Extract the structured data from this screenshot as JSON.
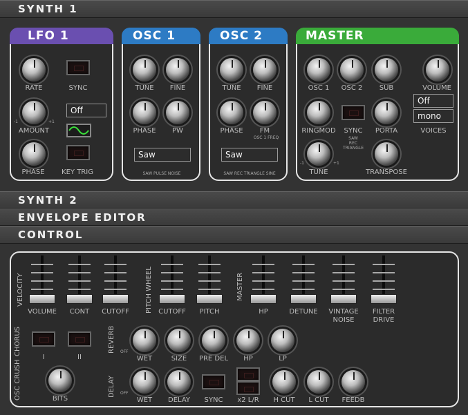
{
  "sections": {
    "synth1": "SYNTH 1",
    "synth2": "SYNTH 2",
    "envelope": "ENVELOPE EDITOR",
    "control": "CONTROL"
  },
  "lfo1": {
    "title": "LFO 1",
    "color": "#6a4fb0",
    "rate": "RATE",
    "sync": "SYNC",
    "sync_value": "Off",
    "amount": "AMOUNT",
    "phase": "PHASE",
    "key_trig": "KEY TRIG",
    "minus": "-1",
    "plus": "+1",
    "wave_icon": "sine-wave-icon"
  },
  "osc1": {
    "title": "OSC 1",
    "color": "#2d7bc4",
    "tune": "TUNE",
    "fine": "FINE",
    "phase": "PHASE",
    "pw": "PW",
    "wave": "Saw",
    "options": "SAW PULSE NOISE",
    "minus": "-1",
    "plus": "+1"
  },
  "osc2": {
    "title": "OSC 2",
    "color": "#2d7bc4",
    "tune": "TUNE",
    "fine": "FINE",
    "phase": "PHASE",
    "fm": "FM",
    "fm_sub": "OSC 1 FREQ",
    "wave": "Saw",
    "options": "SAW REC TRIANGLE SINE",
    "plus": "+1"
  },
  "master": {
    "title": "MASTER",
    "color": "#3aab3a",
    "osc1": "OSC 1",
    "osc2": "OSC 2",
    "sub": "SUB",
    "volume": "VOLUME",
    "ringmod": "RINGMOD",
    "sync": "SYNC",
    "sync_opts": [
      "SAW",
      "REC",
      "TRIANGLE"
    ],
    "porta": "PORTA",
    "porta_value": "Off",
    "voices_value": "mono",
    "voices": "VOICES",
    "tune": "TUNE",
    "transpose": "TRANSPOSE",
    "minus": "-1",
    "plus": "+1"
  },
  "control": {
    "velocity": "VELOCITY",
    "pitch_wheel": "PITCH WHEEL",
    "master": "MASTER",
    "faders": {
      "volume": "VOLUME",
      "cont": "CONT",
      "cutoff": "CUTOFF",
      "pw_cutoff": "CUTOFF",
      "pitch": "PITCH",
      "hp": "HP",
      "detune": "DETUNE",
      "vintage_noise": "VINTAGE NOISE",
      "filter_drive": "FILTER DRIVE"
    },
    "chorus": "CHORUS",
    "chorus_i": "I",
    "chorus_ii": "II",
    "reverb": "REVERB",
    "reverb_knobs": {
      "wet": "WET",
      "size": "SIZE",
      "pre_del": "PRE DEL",
      "hp": "HP",
      "lp": "LP"
    },
    "off": "OFF",
    "osc_crush": "OSC CRUSH",
    "bits": "BITS",
    "delay": "DELAY",
    "delay_knobs": {
      "wet": "WET",
      "delay": "DELAY",
      "sync": "SYNC",
      "x2": "x2 L/R",
      "hcut": "H CUT",
      "lcut": "L CUT",
      "feedb": "FEEDB"
    }
  }
}
